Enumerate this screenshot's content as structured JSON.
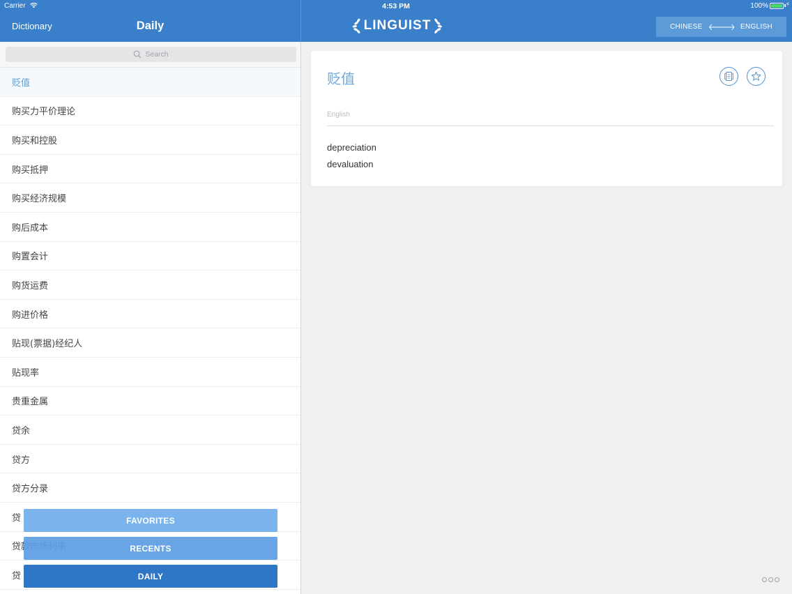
{
  "status_bar": {
    "carrier": "Carrier",
    "time": "4:53 PM",
    "battery": "100%"
  },
  "header": {
    "back_label": "Dictionary",
    "title": "Daily",
    "logo_text": "LINGUIST",
    "lang_from": "CHINESE",
    "lang_to": "ENGLISH"
  },
  "search": {
    "placeholder": "Search"
  },
  "word_list": [
    {
      "label": "贬值",
      "selected": true
    },
    {
      "label": "购买力平价理论"
    },
    {
      "label": "购买和控股"
    },
    {
      "label": "购买抵押"
    },
    {
      "label": "购买经济规模"
    },
    {
      "label": "购后成本"
    },
    {
      "label": "购置会计"
    },
    {
      "label": "购货运费"
    },
    {
      "label": "购进价格"
    },
    {
      "label": "贴现(票据)经纪人"
    },
    {
      "label": "贴现率"
    },
    {
      "label": "贵重金属"
    },
    {
      "label": "贷余"
    },
    {
      "label": "贷方"
    },
    {
      "label": "贷方分录"
    },
    {
      "label": "贷"
    },
    {
      "label": "贷款市场利率"
    },
    {
      "label": "贷"
    }
  ],
  "bottom_tabs": {
    "favorites": "FAVORITES",
    "recents": "RECENTS",
    "daily": "DAILY"
  },
  "entry": {
    "headword": "贬值",
    "language_label": "English",
    "translations": [
      "depreciation",
      "devaluation"
    ]
  },
  "colors": {
    "header_blue": "#3a7fc9",
    "accent": "#6fa8dc",
    "daily_button": "#2f76c6"
  }
}
